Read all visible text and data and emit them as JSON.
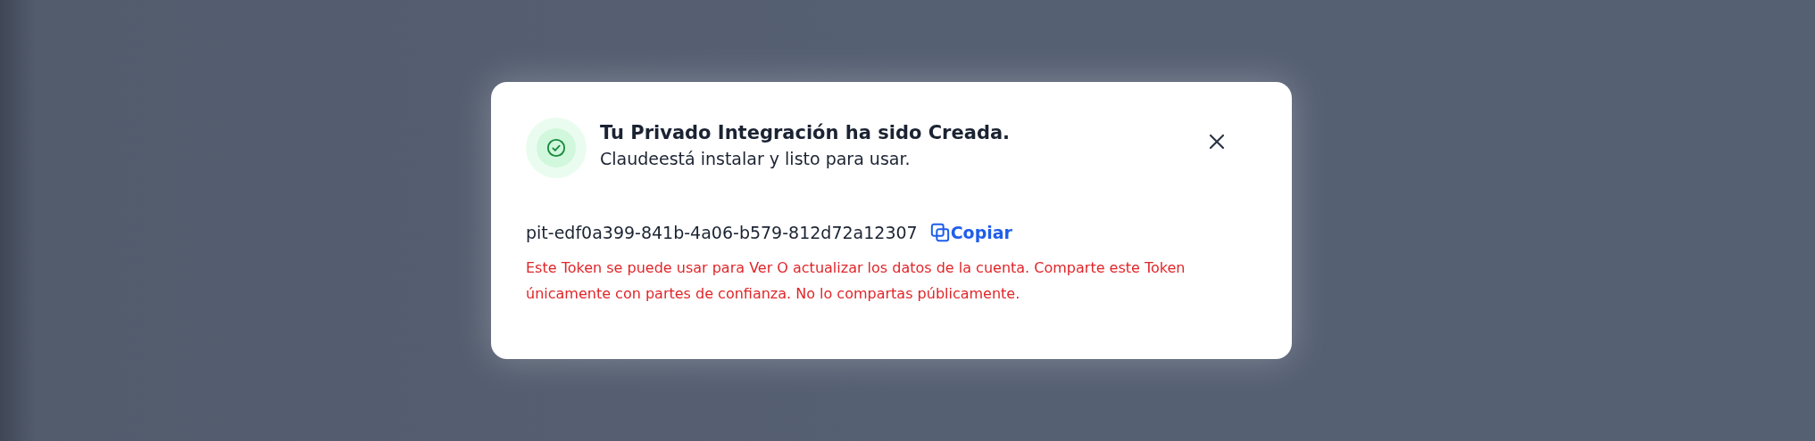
{
  "dialog": {
    "title": "Tu Privado Integración ha sido Creada.",
    "subtitle": "Claudeestá instalar y listo para usar.",
    "token": "pit-edf0a399-841b-4a06-b579-812d72a12307",
    "copy_button": "Copiar",
    "warning": "Este Token se puede usar para Ver O actualizar los datos de la cuenta. Comparte este Token únicamente con partes de confianza. No lo compartas públicamente."
  }
}
